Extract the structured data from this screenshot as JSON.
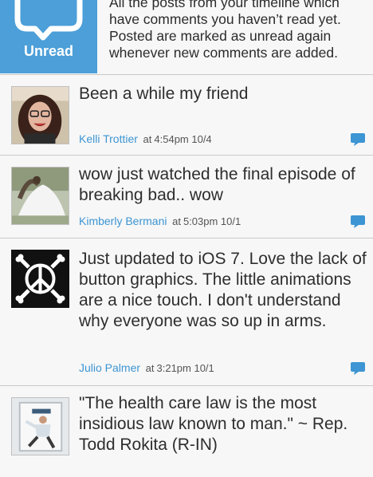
{
  "header": {
    "tile_label": "Unread",
    "description": "All the posts from your timeline which have comments you haven’t read yet. Posted are marked as unread again whenever new comments are added."
  },
  "posts": [
    {
      "text": "Been a while my friend",
      "author": "Kelli Trottier",
      "at": "at",
      "time": "4:54pm 10/4"
    },
    {
      "text": "wow just watched the final episode of breaking bad.. wow",
      "author": "Kimberly Bermani",
      "at": "at",
      "time": "5:03pm 10/1"
    },
    {
      "text": "Just updated to iOS 7. Love the lack of button graphics. The little animations are a nice touch. I don't understand why everyone was so up in arms.",
      "author": "Julio Palmer",
      "at": "at",
      "time": "3:21pm 10/1"
    },
    {
      "text": "\"The health care law is the most insidious law known to man.\" ~ Rep. Todd Rokita (R-IN)"
    }
  ],
  "colors": {
    "accent": "#4c9fd8",
    "link": "#3d95d3",
    "divider": "#c9c9c9"
  },
  "icons": {
    "unread": "comment-bubble-icon",
    "comment": "comment-icon"
  }
}
